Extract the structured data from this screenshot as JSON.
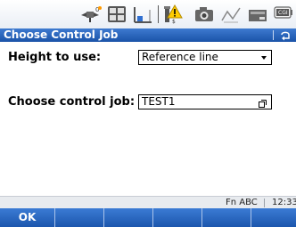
{
  "title_bar": {
    "title": "Choose Control Job"
  },
  "form": {
    "height_label": "Height to use:",
    "height_value": "Reference line",
    "job_label": "Choose control job:",
    "job_value": "TEST1"
  },
  "info_bar": {
    "fn_abc": "Fn ABC",
    "time": "12:33"
  },
  "softkeys": [
    "OK",
    "",
    "",
    "",
    "",
    ""
  ],
  "status_icons": [
    "satellite-icon",
    "level-display-icon",
    "total-station-icon",
    "sensor-warning-icon",
    "camera-icon",
    "compass-icon",
    "battery-icon"
  ],
  "colors": {
    "title_bar": "#1a53a8",
    "softkey_bar": "#1c56ad",
    "info_bar": "#e8ebef"
  }
}
